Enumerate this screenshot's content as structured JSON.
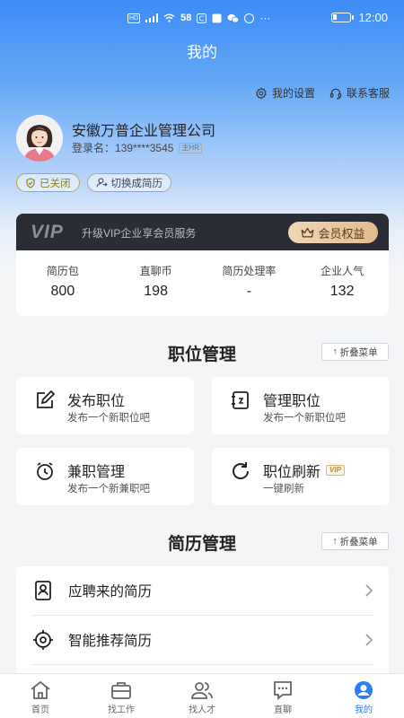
{
  "status_bar": {
    "network": "58",
    "time": "12:00",
    "hd": "HD"
  },
  "header": {
    "title": "我的"
  },
  "top_links": {
    "settings": "我的设置",
    "service": "联系客服"
  },
  "profile": {
    "company": "安徽万普企业管理公司",
    "login_label": "登录名：",
    "login_value": "139****3545",
    "role_tag": "主HR"
  },
  "pills": {
    "status": "已关闭",
    "switch": "切换成简历"
  },
  "vip": {
    "logo": "VIP",
    "text": "升级VIP企业享会员服务",
    "button": "会员权益"
  },
  "stats": [
    {
      "label": "简历包",
      "value": "800"
    },
    {
      "label": "直聊币",
      "value": "198"
    },
    {
      "label": "简历处理率",
      "value": "-"
    },
    {
      "label": "企业人气",
      "value": "132"
    }
  ],
  "position_section": {
    "title": "职位管理",
    "fold": "折叠菜单",
    "cards": [
      {
        "title": "发布职位",
        "sub": "发布一个新职位吧"
      },
      {
        "title": "管理职位",
        "sub": "发布一个新职位吧"
      },
      {
        "title": "兼职管理",
        "sub": "发布一个新兼职吧"
      },
      {
        "title": "职位刷新",
        "sub": "一键刷新",
        "tag": "VIP"
      }
    ]
  },
  "resume_section": {
    "title": "简历管理",
    "fold": "折叠菜单",
    "items": [
      {
        "label": "应聘来的简历"
      },
      {
        "label": "智能推荐简历"
      }
    ]
  },
  "tabbar": {
    "items": [
      {
        "label": "首页"
      },
      {
        "label": "找工作"
      },
      {
        "label": "找人才"
      },
      {
        "label": "直聊"
      },
      {
        "label": "我的"
      }
    ]
  },
  "colors": {
    "accent": "#2f7cf6",
    "vip_bar": "#2a2d33",
    "vip_button": "#e3bb90"
  }
}
